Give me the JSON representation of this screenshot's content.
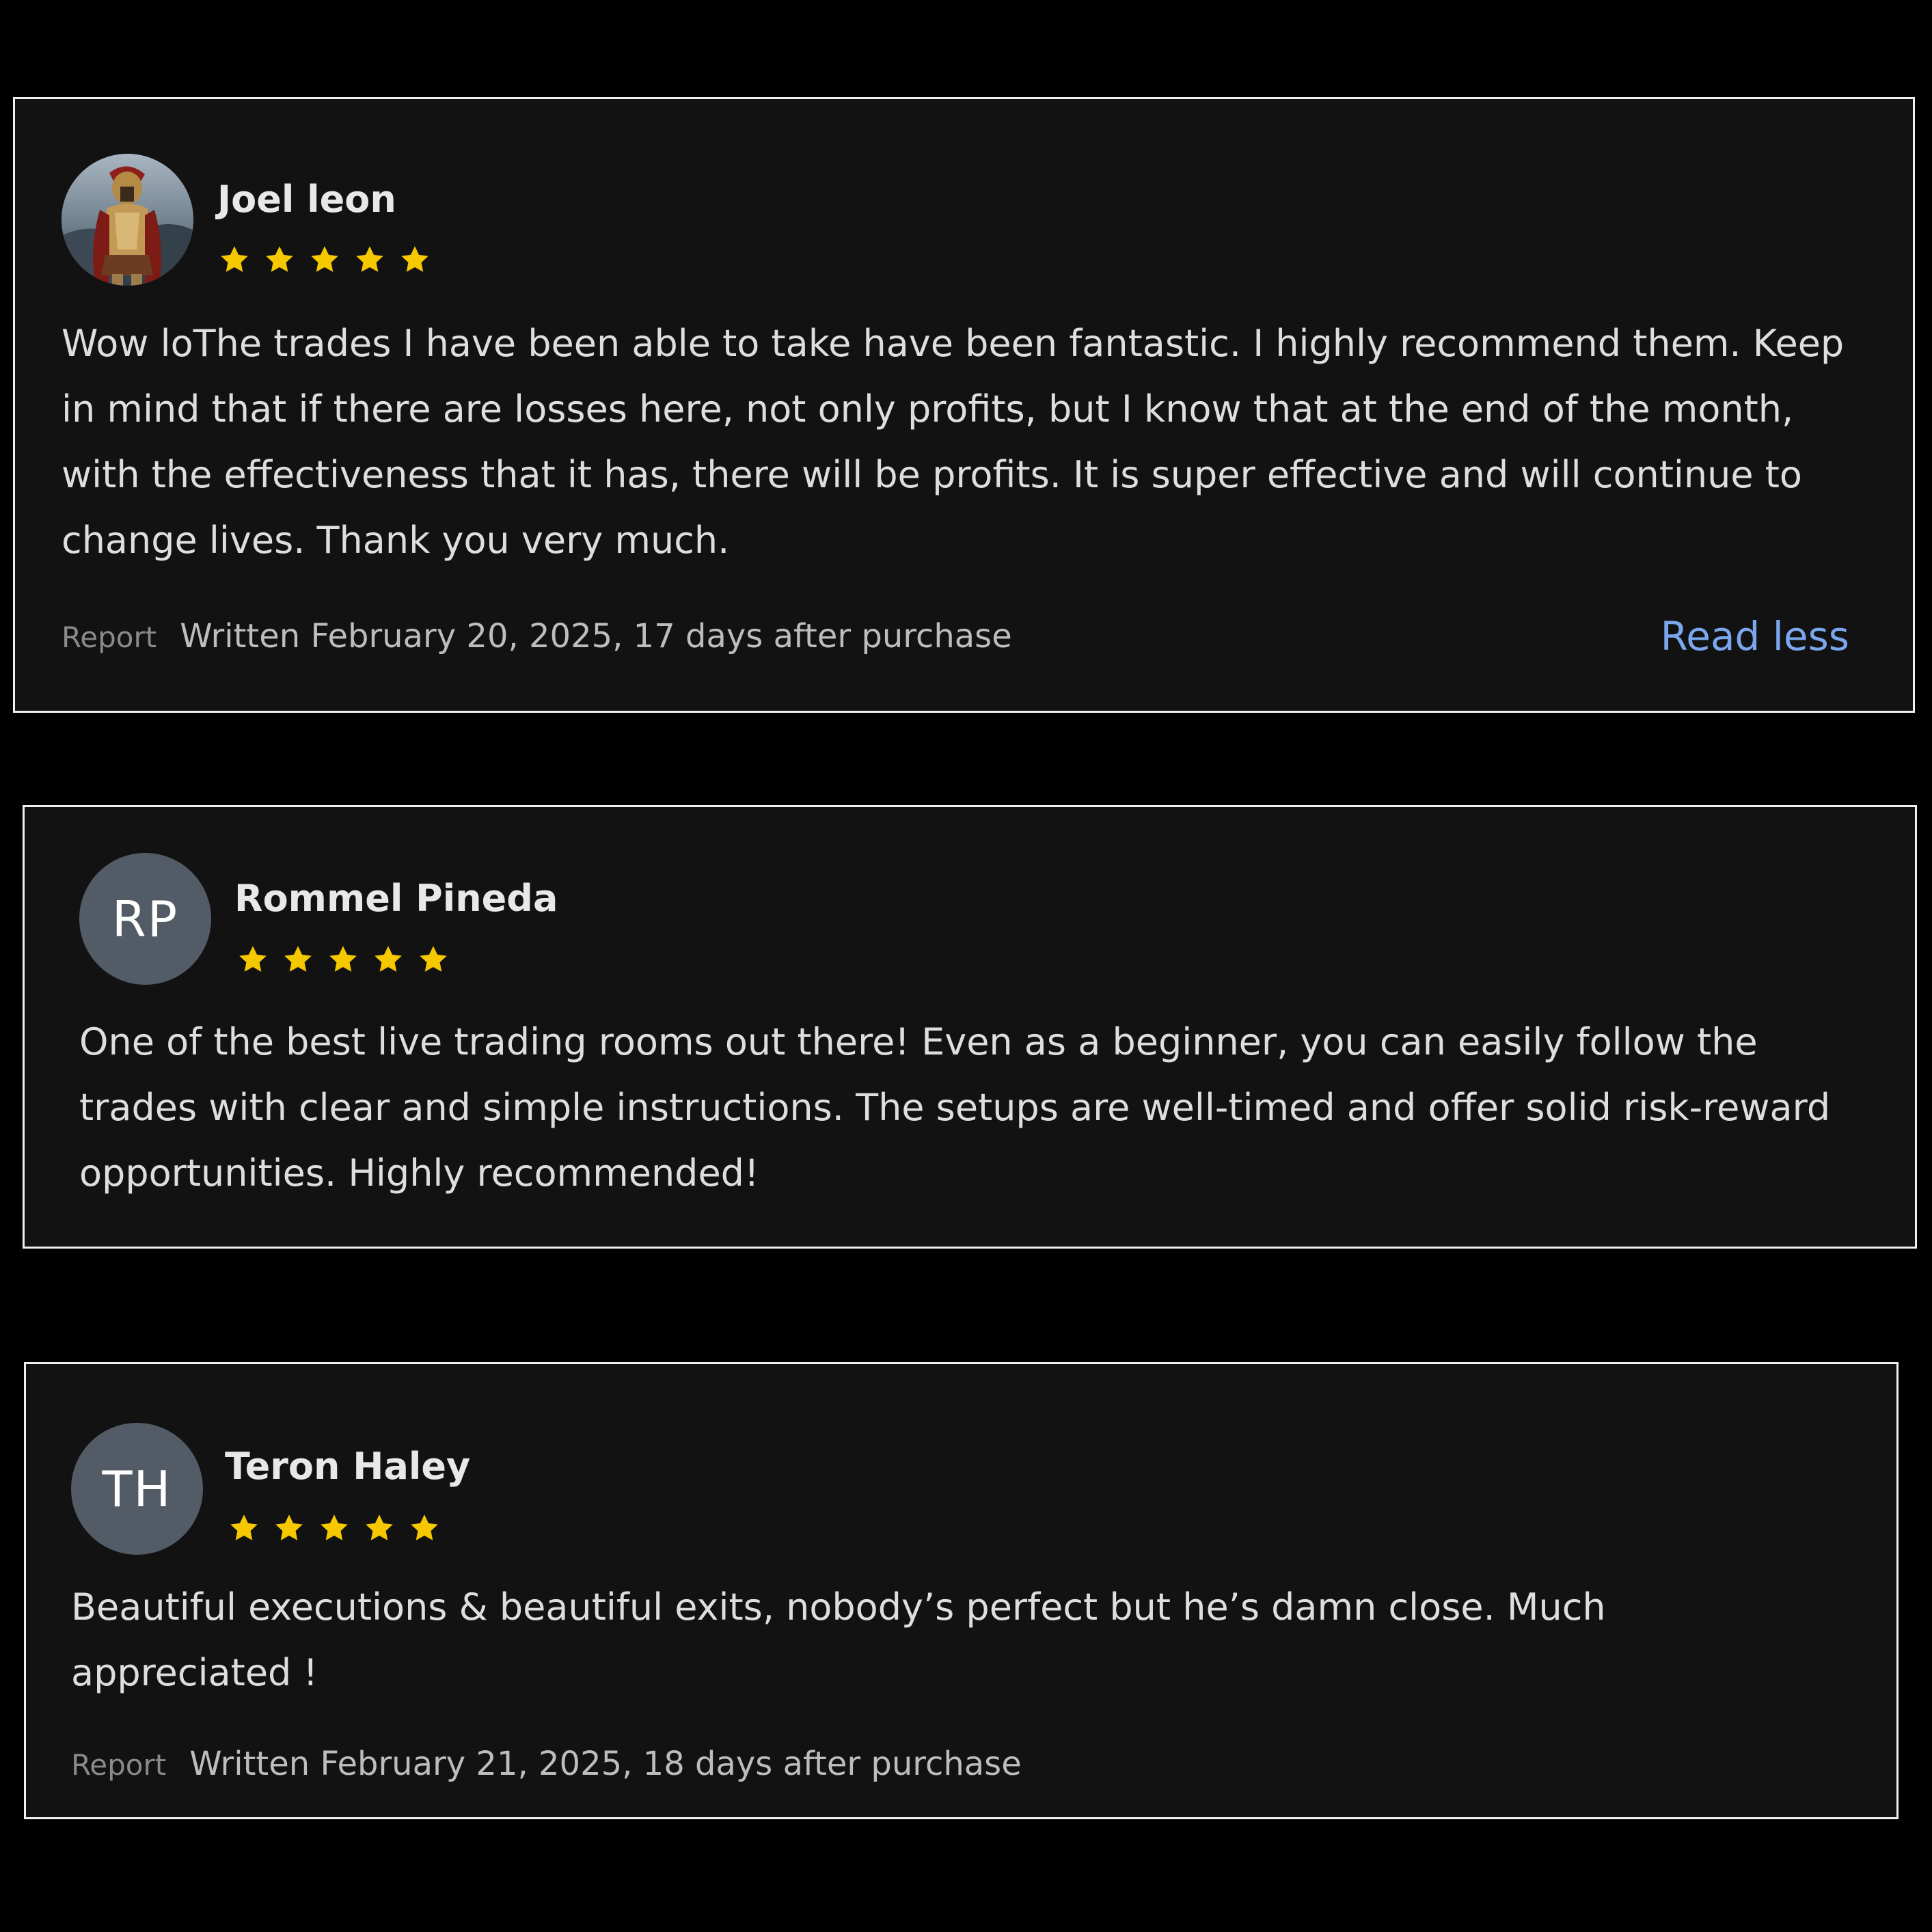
{
  "colors": {
    "background": "#000000",
    "card": "#121212",
    "card_border": "#f0f0f0",
    "star": "#f5c800",
    "link": "#7ba7ee",
    "avatar_bg": "#525b66"
  },
  "reviews": [
    {
      "author": "Joel leon",
      "avatar": {
        "type": "photo",
        "icon": "spartan-warrior-photo"
      },
      "rating": 5,
      "text": "Wow loThe trades I have been able to take have been fantastic. I highly recommend them. Keep in mind that if there are losses here, not only profits, but I know that at the end of the month, with the effectiveness that it has, there will be profits. It is super effective and will continue to change lives. Thank you very much.",
      "report_label": "Report",
      "written": "Written February 20, 2025, 17 days after purchase",
      "toggle_label": "Read less"
    },
    {
      "author": "Rommel Pineda",
      "avatar": {
        "type": "initials",
        "initials": "RP"
      },
      "rating": 5,
      "text": "One of the best live trading rooms out there! Even as a beginner, you can easily follow the trades with clear and simple instructions. The setups are well-timed and offer solid risk-reward opportunities. Highly recommended!"
    },
    {
      "author": "Teron Haley",
      "avatar": {
        "type": "initials",
        "initials": "TH"
      },
      "rating": 5,
      "text": "Beautiful executions & beautiful exits, nobody’s perfect but he’s damn close. Much appreciated !",
      "report_label": "Report",
      "written": "Written February 21, 2025, 18 days after purchase"
    }
  ]
}
